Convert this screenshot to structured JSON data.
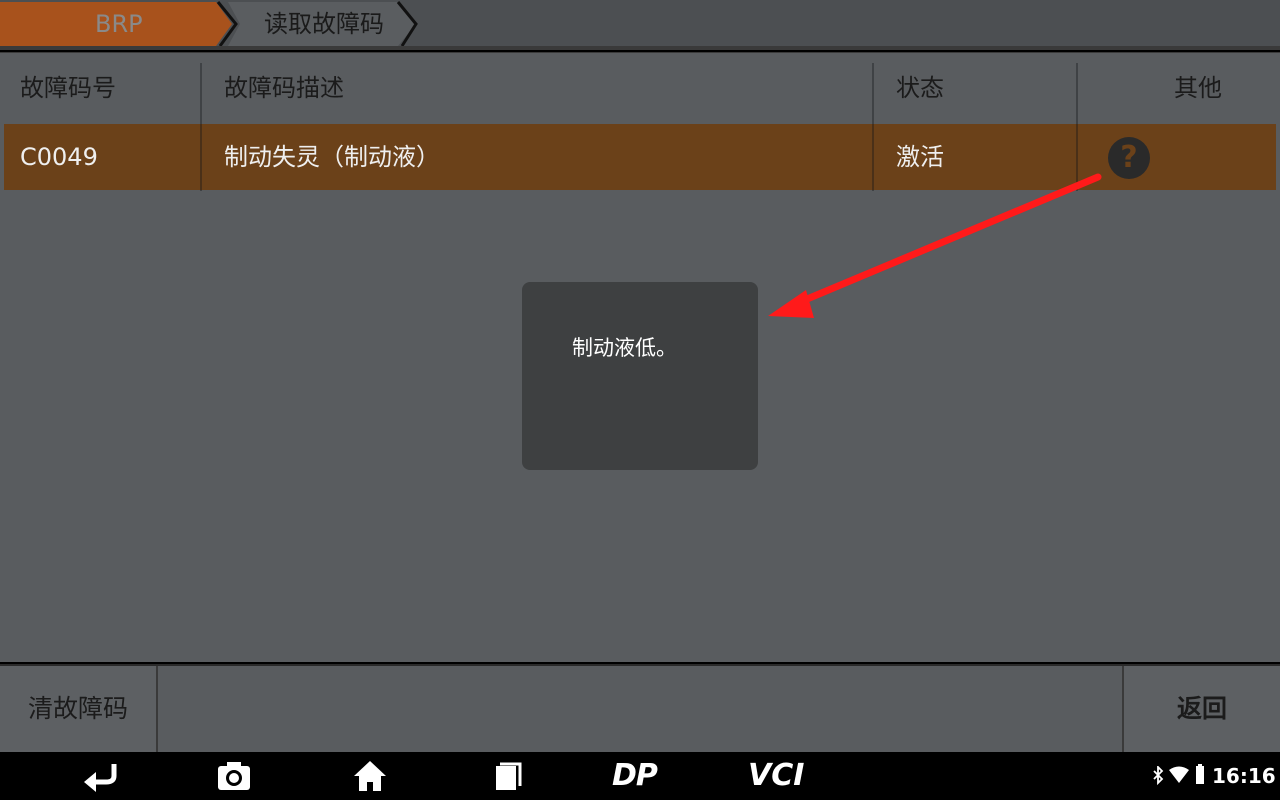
{
  "breadcrumb": {
    "items": [
      "BRP",
      "读取故障码"
    ]
  },
  "table": {
    "headers": [
      "故障码号",
      "故障码描述",
      "状态",
      "其他"
    ],
    "rows": [
      {
        "code": "C0049",
        "description": "制动失灵（制动液）",
        "status": "激活"
      }
    ]
  },
  "popup": {
    "text": "制动液低。"
  },
  "bottom_bar": {
    "clear_label": "清故障码",
    "back_label": "返回"
  },
  "navbar": {
    "icons": [
      "back-icon",
      "camera-icon",
      "home-icon",
      "recent-apps-icon",
      "dp-logo",
      "vci-logo"
    ],
    "dp_label": "DP",
    "vci_label": "VCI"
  },
  "status": {
    "time": "16:16",
    "icons": [
      "bluetooth-icon",
      "wifi-icon",
      "battery-icon"
    ]
  },
  "colors": {
    "accent_orange": "#a8521c",
    "row_highlight": "#6b4119",
    "annotation_arrow": "#ff1a1a"
  }
}
